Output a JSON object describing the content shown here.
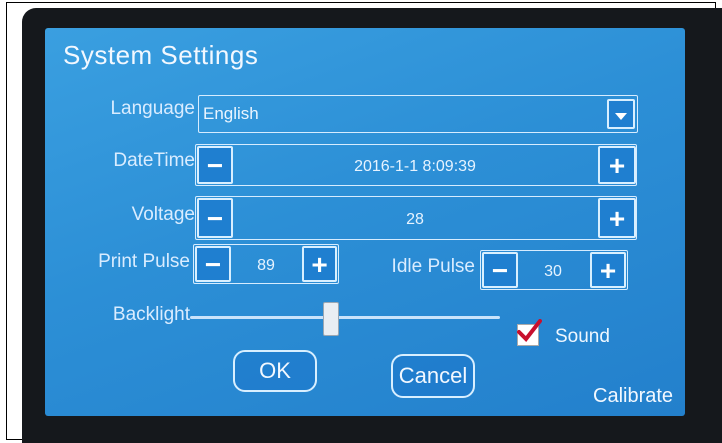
{
  "window": {
    "title": "System Settings"
  },
  "language": {
    "label": "Language",
    "value": "English"
  },
  "datetime": {
    "label": "DateTime",
    "value": "2016-1-1 8:09:39",
    "minus": "−",
    "plus": "+"
  },
  "voltage": {
    "label": "Voltage",
    "value": "28",
    "minus": "−",
    "plus": "+"
  },
  "print_pulse": {
    "label": "Print Pulse",
    "value": "89",
    "minus": "−",
    "plus": "+"
  },
  "idle_pulse": {
    "label": "Idle Pulse",
    "value": "30",
    "minus": "−",
    "plus": "+"
  },
  "backlight": {
    "label": "Backlight",
    "level": 0.45
  },
  "sound": {
    "label": "Sound",
    "checked": true
  },
  "buttons": {
    "ok": "OK",
    "cancel": "Cancel",
    "calibrate": "Calibrate"
  },
  "icons": {
    "dropdown": "chevron-down-icon",
    "check": "checkmark-icon"
  }
}
